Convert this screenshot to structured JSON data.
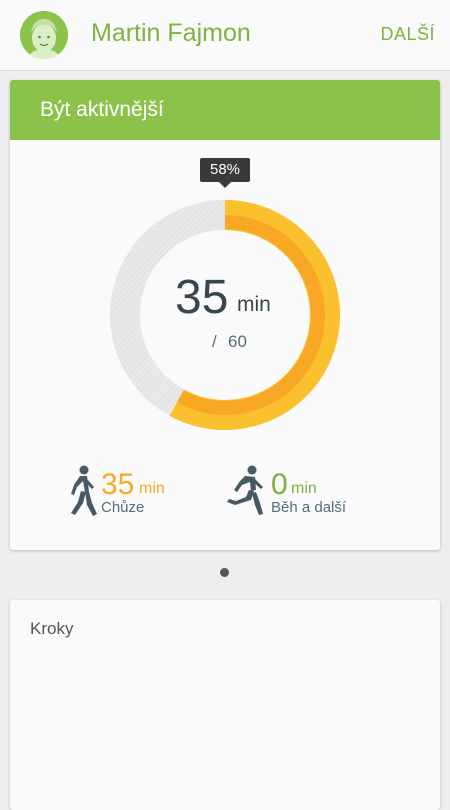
{
  "header": {
    "user_name": "Martin Fajmon",
    "more_label": "DALŠÍ",
    "accent_color": "#7cb342"
  },
  "activity_card": {
    "title": "Být aktivnější",
    "progress_percent_label": "58%",
    "progress_fraction": 0.58,
    "active_minutes": "35",
    "unit": "min",
    "goal_slash": "/",
    "goal_minutes": "60",
    "ring_colors": {
      "track": "#e8e8e8",
      "outer": "#fbc02d",
      "inner": "#f9a825"
    },
    "stats": [
      {
        "value": "35",
        "unit": "min",
        "label": "Chůze",
        "icon": "walking-person-icon",
        "color": "#f9a825"
      },
      {
        "value": "0",
        "unit": "min",
        "label": "Běh a další",
        "icon": "running-person-icon",
        "color": "#7cb342"
      }
    ]
  },
  "pager": {
    "pages": 1,
    "active_page": 1
  },
  "steps_card": {
    "title": "Kroky"
  }
}
